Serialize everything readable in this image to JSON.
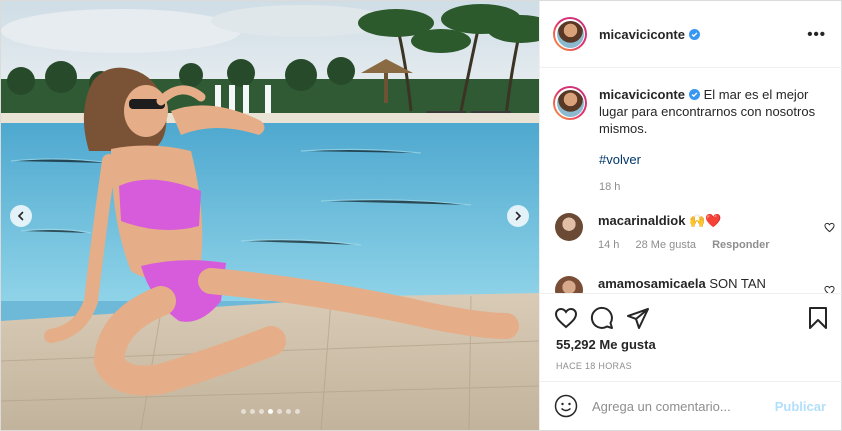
{
  "post": {
    "username": "micaviciconte",
    "caption": "El mar es el mejor lugar para encontrarnos con nosotros mismos.",
    "hashtag": "#volver",
    "time": "18 h",
    "carousel": {
      "total_slides": 7,
      "active_slide": 4
    }
  },
  "comments": [
    {
      "username": "macarinaldiok",
      "text": "🙌❤️",
      "time": "14 h",
      "likes": "28 Me gusta",
      "reply": "Responder"
    },
    {
      "username": "amamosamicaela",
      "text": "SON TAN"
    }
  ],
  "actions": {
    "likes": "55,292 Me gusta",
    "posted": "HACE 18 HORAS"
  },
  "composer": {
    "placeholder": "Agrega un comentario...",
    "publish": "Publicar"
  },
  "icons": [
    "heart-icon",
    "comment-icon",
    "share-icon",
    "bookmark-icon",
    "emoji-icon",
    "more-options-icon",
    "verified-icon",
    "chevron-left-icon",
    "chevron-right-icon"
  ],
  "colors": {
    "verified": "#3897f0",
    "link": "#00376b",
    "publish_disabled": "#b2dffc",
    "muted": "#8e8e8e"
  }
}
